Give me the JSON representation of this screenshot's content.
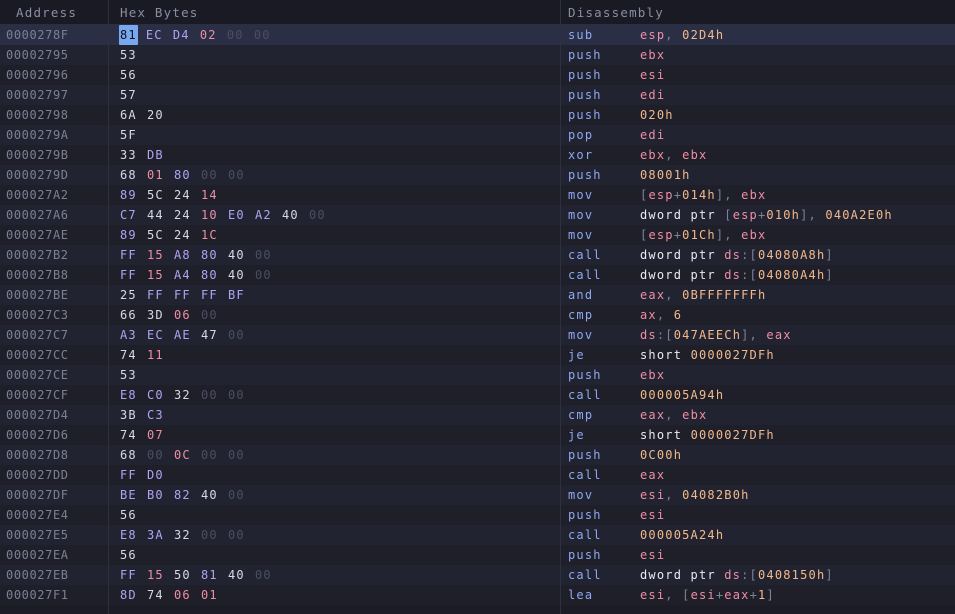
{
  "header": {
    "address_label": "Address",
    "hex_label": "Hex Bytes",
    "disasm_label": "Disassembly"
  },
  "colors": {
    "background": "#1b1c26",
    "mnemonic": "#8fa8f3",
    "register": "#ef8ea6",
    "immediate": "#f3b98b",
    "byte_normal": "#d7d9e4",
    "byte_purple": "#b2a3f2",
    "byte_red": "#ef8ea6",
    "byte_zero": "#4b4e63",
    "selection": "#78a9f0"
  },
  "rows": [
    {
      "addr": "0000278F",
      "selected": true,
      "bytes": [
        [
          "81",
          "s"
        ],
        [
          "EC",
          "p"
        ],
        [
          "D4",
          "p"
        ],
        [
          "02",
          "r"
        ],
        [
          "00",
          "z"
        ],
        [
          "00",
          "z"
        ]
      ],
      "mn": "sub",
      "ops": [
        [
          "esp",
          "r"
        ],
        [
          ", ",
          "d"
        ],
        [
          "02D4h",
          "o"
        ]
      ]
    },
    {
      "addr": "00002795",
      "bytes": [
        [
          "53",
          "n"
        ]
      ],
      "mn": "push",
      "ops": [
        [
          "ebx",
          "r"
        ]
      ]
    },
    {
      "addr": "00002796",
      "bytes": [
        [
          "56",
          "n"
        ]
      ],
      "mn": "push",
      "ops": [
        [
          "esi",
          "r"
        ]
      ]
    },
    {
      "addr": "00002797",
      "bytes": [
        [
          "57",
          "n"
        ]
      ],
      "mn": "push",
      "ops": [
        [
          "edi",
          "r"
        ]
      ]
    },
    {
      "addr": "00002798",
      "bytes": [
        [
          "6A",
          "n"
        ],
        [
          "20",
          "n"
        ]
      ],
      "mn": "push",
      "ops": [
        [
          "020h",
          "o"
        ]
      ]
    },
    {
      "addr": "0000279A",
      "bytes": [
        [
          "5F",
          "n"
        ]
      ],
      "mn": "pop",
      "ops": [
        [
          "edi",
          "r"
        ]
      ]
    },
    {
      "addr": "0000279B",
      "bytes": [
        [
          "33",
          "n"
        ],
        [
          "DB",
          "p"
        ]
      ],
      "mn": "xor",
      "ops": [
        [
          "ebx",
          "r"
        ],
        [
          ", ",
          "d"
        ],
        [
          "ebx",
          "r"
        ]
      ]
    },
    {
      "addr": "0000279D",
      "bytes": [
        [
          "68",
          "n"
        ],
        [
          "01",
          "r"
        ],
        [
          "80",
          "p"
        ],
        [
          "00",
          "z"
        ],
        [
          "00",
          "z"
        ]
      ],
      "mn": "push",
      "ops": [
        [
          "08001h",
          "o"
        ]
      ]
    },
    {
      "addr": "000027A2",
      "bytes": [
        [
          "89",
          "p"
        ],
        [
          "5C",
          "n"
        ],
        [
          "24",
          "n"
        ],
        [
          "14",
          "r"
        ]
      ],
      "mn": "mov",
      "ops": [
        [
          "[",
          "d"
        ],
        [
          "esp",
          "r"
        ],
        [
          "+",
          "d"
        ],
        [
          "014h",
          "o"
        ],
        [
          "], ",
          "d"
        ],
        [
          "ebx",
          "r"
        ]
      ]
    },
    {
      "addr": "000027A6",
      "bytes": [
        [
          "C7",
          "p"
        ],
        [
          "44",
          "n"
        ],
        [
          "24",
          "n"
        ],
        [
          "10",
          "r"
        ],
        [
          "E0",
          "p"
        ],
        [
          "A2",
          "p"
        ],
        [
          "40",
          "n"
        ],
        [
          "00",
          "z"
        ]
      ],
      "mn": "mov",
      "ops": [
        [
          "dword ptr ",
          "n"
        ],
        [
          "[",
          "d"
        ],
        [
          "esp",
          "r"
        ],
        [
          "+",
          "d"
        ],
        [
          "010h",
          "o"
        ],
        [
          "], ",
          "d"
        ],
        [
          "040A2E0h",
          "o"
        ]
      ]
    },
    {
      "addr": "000027AE",
      "bytes": [
        [
          "89",
          "p"
        ],
        [
          "5C",
          "n"
        ],
        [
          "24",
          "n"
        ],
        [
          "1C",
          "r"
        ]
      ],
      "mn": "mov",
      "ops": [
        [
          "[",
          "d"
        ],
        [
          "esp",
          "r"
        ],
        [
          "+",
          "d"
        ],
        [
          "01Ch",
          "o"
        ],
        [
          "], ",
          "d"
        ],
        [
          "ebx",
          "r"
        ]
      ]
    },
    {
      "addr": "000027B2",
      "bytes": [
        [
          "FF",
          "p"
        ],
        [
          "15",
          "r"
        ],
        [
          "A8",
          "p"
        ],
        [
          "80",
          "p"
        ],
        [
          "40",
          "n"
        ],
        [
          "00",
          "z"
        ]
      ],
      "mn": "call",
      "ops": [
        [
          "dword ptr ",
          "n"
        ],
        [
          "ds",
          "r"
        ],
        [
          ":[",
          "d"
        ],
        [
          "04080A8h",
          "o"
        ],
        [
          "]",
          "d"
        ]
      ]
    },
    {
      "addr": "000027B8",
      "bytes": [
        [
          "FF",
          "p"
        ],
        [
          "15",
          "r"
        ],
        [
          "A4",
          "p"
        ],
        [
          "80",
          "p"
        ],
        [
          "40",
          "n"
        ],
        [
          "00",
          "z"
        ]
      ],
      "mn": "call",
      "ops": [
        [
          "dword ptr ",
          "n"
        ],
        [
          "ds",
          "r"
        ],
        [
          ":[",
          "d"
        ],
        [
          "04080A4h",
          "o"
        ],
        [
          "]",
          "d"
        ]
      ]
    },
    {
      "addr": "000027BE",
      "bytes": [
        [
          "25",
          "n"
        ],
        [
          "FF",
          "p"
        ],
        [
          "FF",
          "p"
        ],
        [
          "FF",
          "p"
        ],
        [
          "BF",
          "p"
        ]
      ],
      "mn": "and",
      "ops": [
        [
          "eax",
          "r"
        ],
        [
          ", ",
          "d"
        ],
        [
          "0BFFFFFFFh",
          "o"
        ]
      ]
    },
    {
      "addr": "000027C3",
      "bytes": [
        [
          "66",
          "n"
        ],
        [
          "3D",
          "n"
        ],
        [
          "06",
          "r"
        ],
        [
          "00",
          "z"
        ]
      ],
      "mn": "cmp",
      "ops": [
        [
          "ax",
          "r"
        ],
        [
          ", ",
          "d"
        ],
        [
          "6",
          "o"
        ]
      ]
    },
    {
      "addr": "000027C7",
      "bytes": [
        [
          "A3",
          "p"
        ],
        [
          "EC",
          "p"
        ],
        [
          "AE",
          "p"
        ],
        [
          "47",
          "n"
        ],
        [
          "00",
          "z"
        ]
      ],
      "mn": "mov",
      "ops": [
        [
          "ds",
          "r"
        ],
        [
          ":[",
          "d"
        ],
        [
          "047AEECh",
          "o"
        ],
        [
          "], ",
          "d"
        ],
        [
          "eax",
          "r"
        ]
      ]
    },
    {
      "addr": "000027CC",
      "bytes": [
        [
          "74",
          "n"
        ],
        [
          "11",
          "r"
        ]
      ],
      "mn": "je",
      "ops": [
        [
          "short ",
          "n"
        ],
        [
          "0000027DFh",
          "o"
        ]
      ]
    },
    {
      "addr": "000027CE",
      "bytes": [
        [
          "53",
          "n"
        ]
      ],
      "mn": "push",
      "ops": [
        [
          "ebx",
          "r"
        ]
      ]
    },
    {
      "addr": "000027CF",
      "bytes": [
        [
          "E8",
          "p"
        ],
        [
          "C0",
          "p"
        ],
        [
          "32",
          "n"
        ],
        [
          "00",
          "z"
        ],
        [
          "00",
          "z"
        ]
      ],
      "mn": "call",
      "ops": [
        [
          "000005A94h",
          "o"
        ]
      ]
    },
    {
      "addr": "000027D4",
      "bytes": [
        [
          "3B",
          "n"
        ],
        [
          "C3",
          "p"
        ]
      ],
      "mn": "cmp",
      "ops": [
        [
          "eax",
          "r"
        ],
        [
          ", ",
          "d"
        ],
        [
          "ebx",
          "r"
        ]
      ]
    },
    {
      "addr": "000027D6",
      "bytes": [
        [
          "74",
          "n"
        ],
        [
          "07",
          "r"
        ]
      ],
      "mn": "je",
      "ops": [
        [
          "short ",
          "n"
        ],
        [
          "0000027DFh",
          "o"
        ]
      ]
    },
    {
      "addr": "000027D8",
      "bytes": [
        [
          "68",
          "n"
        ],
        [
          "00",
          "z"
        ],
        [
          "0C",
          "r"
        ],
        [
          "00",
          "z"
        ],
        [
          "00",
          "z"
        ]
      ],
      "mn": "push",
      "ops": [
        [
          "0C00h",
          "o"
        ]
      ]
    },
    {
      "addr": "000027DD",
      "bytes": [
        [
          "FF",
          "p"
        ],
        [
          "D0",
          "p"
        ]
      ],
      "mn": "call",
      "ops": [
        [
          "eax",
          "r"
        ]
      ]
    },
    {
      "addr": "000027DF",
      "bytes": [
        [
          "BE",
          "p"
        ],
        [
          "B0",
          "p"
        ],
        [
          "82",
          "p"
        ],
        [
          "40",
          "n"
        ],
        [
          "00",
          "z"
        ]
      ],
      "mn": "mov",
      "ops": [
        [
          "esi",
          "r"
        ],
        [
          ", ",
          "d"
        ],
        [
          "04082B0h",
          "o"
        ]
      ]
    },
    {
      "addr": "000027E4",
      "bytes": [
        [
          "56",
          "n"
        ]
      ],
      "mn": "push",
      "ops": [
        [
          "esi",
          "r"
        ]
      ]
    },
    {
      "addr": "000027E5",
      "bytes": [
        [
          "E8",
          "p"
        ],
        [
          "3A",
          "p"
        ],
        [
          "32",
          "n"
        ],
        [
          "00",
          "z"
        ],
        [
          "00",
          "z"
        ]
      ],
      "mn": "call",
      "ops": [
        [
          "000005A24h",
          "o"
        ]
      ]
    },
    {
      "addr": "000027EA",
      "bytes": [
        [
          "56",
          "n"
        ]
      ],
      "mn": "push",
      "ops": [
        [
          "esi",
          "r"
        ]
      ]
    },
    {
      "addr": "000027EB",
      "bytes": [
        [
          "FF",
          "p"
        ],
        [
          "15",
          "r"
        ],
        [
          "50",
          "n"
        ],
        [
          "81",
          "p"
        ],
        [
          "40",
          "n"
        ],
        [
          "00",
          "z"
        ]
      ],
      "mn": "call",
      "ops": [
        [
          "dword ptr ",
          "n"
        ],
        [
          "ds",
          "r"
        ],
        [
          ":[",
          "d"
        ],
        [
          "0408150h",
          "o"
        ],
        [
          "]",
          "d"
        ]
      ]
    },
    {
      "addr": "000027F1",
      "bytes": [
        [
          "8D",
          "p"
        ],
        [
          "74",
          "n"
        ],
        [
          "06",
          "r"
        ],
        [
          "01",
          "r"
        ]
      ],
      "mn": "lea",
      "ops": [
        [
          "esi",
          "r"
        ],
        [
          ", ",
          "d"
        ],
        [
          "[",
          "d"
        ],
        [
          "esi",
          "r"
        ],
        [
          "+",
          "d"
        ],
        [
          "eax",
          "r"
        ],
        [
          "+",
          "d"
        ],
        [
          "1",
          "o"
        ],
        [
          "]",
          "d"
        ]
      ]
    }
  ]
}
